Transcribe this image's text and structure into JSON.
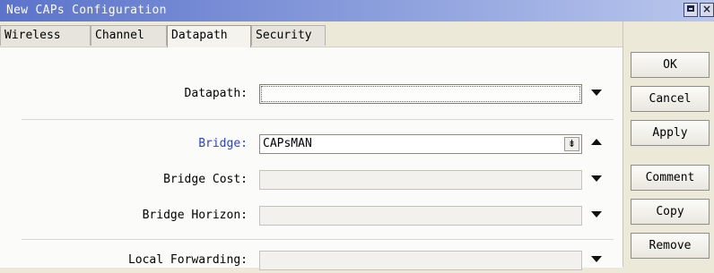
{
  "window": {
    "title": "New CAPs Configuration"
  },
  "tabs": [
    {
      "label": "Wireless",
      "active": false
    },
    {
      "label": "Channel",
      "active": false
    },
    {
      "label": "Datapath",
      "active": true
    },
    {
      "label": "Security",
      "active": false
    }
  ],
  "form": {
    "datapath": {
      "label": "Datapath:",
      "value": ""
    },
    "bridge": {
      "label": "Bridge:",
      "value": "CAPsMAN"
    },
    "bridge_cost": {
      "label": "Bridge Cost:",
      "value": ""
    },
    "bridge_horizon": {
      "label": "Bridge Horizon:",
      "value": ""
    },
    "local_forwarding": {
      "label": "Local Forwarding:",
      "value": ""
    }
  },
  "actions": {
    "ok": "OK",
    "cancel": "Cancel",
    "apply": "Apply",
    "comment": "Comment",
    "copy": "Copy",
    "remove": "Remove"
  },
  "colors": {
    "titlebar_start": "#5b73ca",
    "link_label": "#2b43c9"
  },
  "icons": {
    "dropdown": "down-arrow-icon",
    "collapse": "up-arrow-icon",
    "list_select": "list-select-icon"
  }
}
